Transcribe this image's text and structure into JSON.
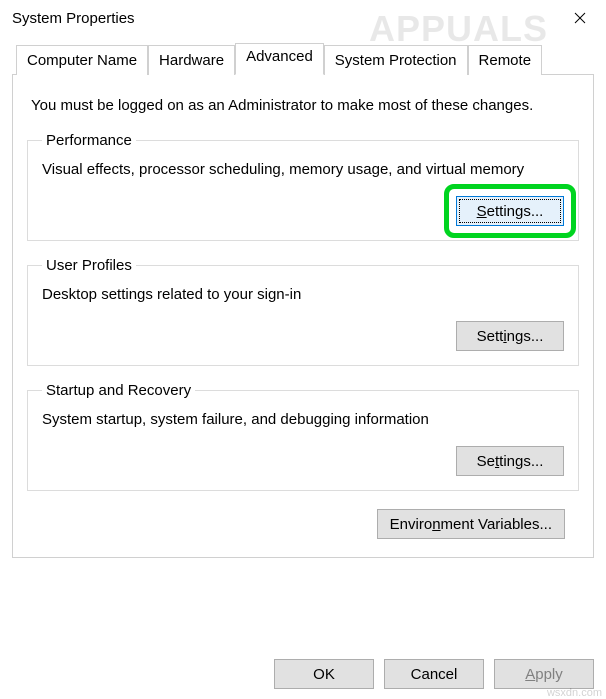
{
  "window": {
    "title": "System Properties"
  },
  "tabs": {
    "computer_name": "Computer Name",
    "hardware": "Hardware",
    "advanced": "Advanced",
    "system_protection": "System Protection",
    "remote": "Remote"
  },
  "panel": {
    "intro": "You must be logged on as an Administrator to make most of these changes.",
    "performance": {
      "legend": "Performance",
      "desc": "Visual effects, processor scheduling, memory usage, and virtual memory",
      "button_prefix": "S",
      "button_suffix": "ettings..."
    },
    "user_profiles": {
      "legend": "User Profiles",
      "desc": "Desktop settings related to your sign-in",
      "button_prefix": "Sett",
      "button_suffix": "ngs...",
      "button_mid": "i"
    },
    "startup": {
      "legend": "Startup and Recovery",
      "desc": "System startup, system failure, and debugging information",
      "button_prefix": "Se",
      "button_suffix": "tings...",
      "button_mid": "t"
    },
    "envvar": {
      "button_prefix": "Enviro",
      "button_mid": "n",
      "button_suffix": "ment Variables..."
    }
  },
  "dialog_buttons": {
    "ok": "OK",
    "cancel": "Cancel",
    "apply_prefix": "A",
    "apply_suffix": "pply"
  },
  "watermark": {
    "main": "APPUALS",
    "sub": "wsxdn.com"
  }
}
